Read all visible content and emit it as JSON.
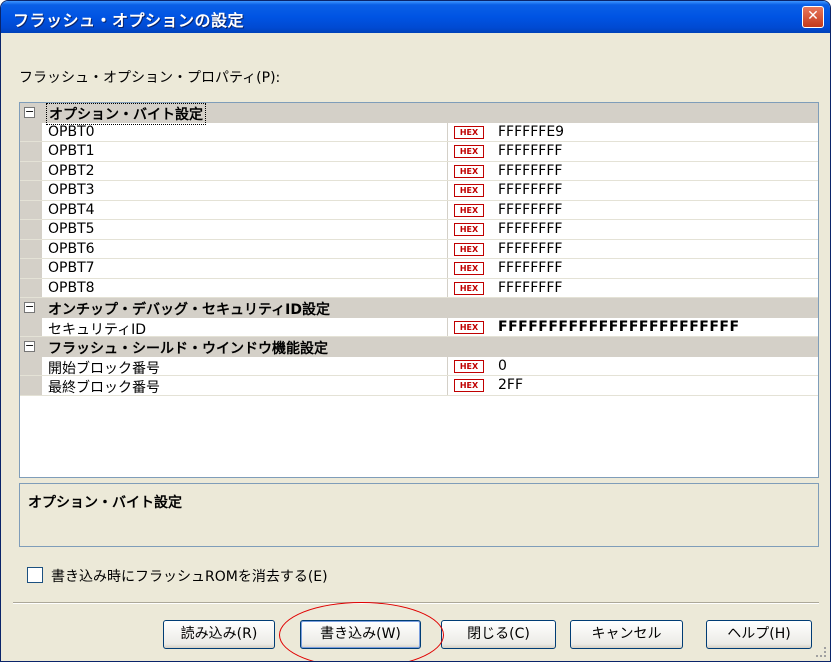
{
  "window": {
    "title": "フラッシュ・オプションの設定",
    "close_label": "✕"
  },
  "property_caption": "フラッシュ・オプション・プロパティ(P):",
  "groups": [
    {
      "label": "オプション・バイト設定",
      "expander": "−",
      "rows": [
        {
          "name": "OPBT0",
          "badge": "HEX",
          "value": "FFFFFFE9"
        },
        {
          "name": "OPBT1",
          "badge": "HEX",
          "value": "FFFFFFFF"
        },
        {
          "name": "OPBT2",
          "badge": "HEX",
          "value": "FFFFFFFF"
        },
        {
          "name": "OPBT3",
          "badge": "HEX",
          "value": "FFFFFFFF"
        },
        {
          "name": "OPBT4",
          "badge": "HEX",
          "value": "FFFFFFFF"
        },
        {
          "name": "OPBT5",
          "badge": "HEX",
          "value": "FFFFFFFF"
        },
        {
          "name": "OPBT6",
          "badge": "HEX",
          "value": "FFFFFFFF"
        },
        {
          "name": "OPBT7",
          "badge": "HEX",
          "value": "FFFFFFFF"
        },
        {
          "name": "OPBT8",
          "badge": "HEX",
          "value": "FFFFFFFF"
        }
      ]
    },
    {
      "label": "オンチップ・デバッグ・セキュリティID設定",
      "expander": "−",
      "rows": [
        {
          "name": "セキュリティID",
          "badge": "HEX",
          "value": "FFFFFFFFFFFFFFFFFFFFFFFF"
        }
      ]
    },
    {
      "label": "フラッシュ・シールド・ウインドウ機能設定",
      "expander": "−",
      "rows": [
        {
          "name": "開始ブロック番号",
          "badge": "HEX",
          "value": "0"
        },
        {
          "name": "最終ブロック番号",
          "badge": "HEX",
          "value": "2FF"
        }
      ]
    }
  ],
  "description": {
    "title": "オプション・バイト設定"
  },
  "erase_checkbox": {
    "label": "書き込み時にフラッシュROMを消去する(E)",
    "checked": false
  },
  "buttons": {
    "read": "読み込み(R)",
    "write": "書き込み(W)",
    "close": "閉じる(C)",
    "cancel": "キャンセル",
    "help": "ヘルプ(H)"
  },
  "colors": {
    "title_bar": "#0054e3",
    "hex_badge": "#c00000",
    "highlight_ring": "#e00000"
  }
}
